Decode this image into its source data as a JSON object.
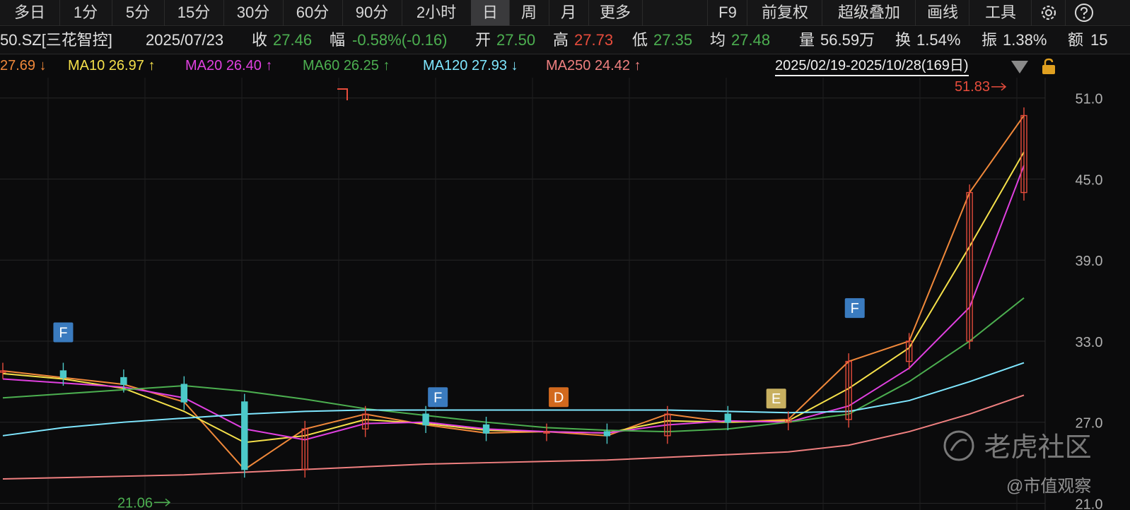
{
  "tabs": {
    "items": [
      "多日",
      "1分",
      "5分",
      "15分",
      "30分",
      "60分",
      "90分",
      "2小时",
      "日",
      "周",
      "月",
      "更多"
    ],
    "active": "日"
  },
  "toolbar": {
    "f9": "F9",
    "adjust": "前复权",
    "overlay": "超级叠加",
    "draw": "画线",
    "tools": "工具"
  },
  "quote": {
    "code_name": "50.SZ[三花智控]",
    "date": "2025/07/23",
    "close_label": "收",
    "close": "27.46",
    "change_label": "幅",
    "change": "-0.58%(-0.16)",
    "open_label": "开",
    "open": "27.50",
    "high_label": "高",
    "high": "27.73",
    "low_label": "低",
    "low": "27.35",
    "avg_label": "均",
    "avg": "27.48",
    "vol_label": "量",
    "volume": "56.59万",
    "turnover_label": "换",
    "turnover": "1.54%",
    "amp_label": "振",
    "amplitude": "1.38%",
    "amount_label": "额",
    "amount": "15"
  },
  "ma_legend": [
    {
      "name": "",
      "value": "27.69",
      "arrow": "↓",
      "color": "#f0883a"
    },
    {
      "name": "MA10",
      "value": "26.97",
      "arrow": "↑",
      "color": "#f5e04a"
    },
    {
      "name": "MA20",
      "value": "26.40",
      "arrow": "↑",
      "color": "#e040e0"
    },
    {
      "name": "MA60",
      "value": "26.25",
      "arrow": "↑",
      "color": "#4caf50"
    },
    {
      "name": "MA120",
      "value": "27.93",
      "arrow": "↓",
      "color": "#7fe7ff"
    },
    {
      "name": "MA250",
      "value": "24.42",
      "arrow": "↑",
      "color": "#f08080"
    }
  ],
  "date_range": "2025/02/19-2025/10/28(169日)",
  "chart_data": {
    "type": "line",
    "title": "",
    "xlabel": "",
    "ylabel": "",
    "ylim": [
      21.0,
      52.0
    ],
    "y_ticks": [
      "51.0",
      "45.0",
      "39.0",
      "33.0",
      "27.0",
      "21.0"
    ],
    "x": [
      0,
      10,
      20,
      30,
      40,
      50,
      60,
      70,
      80,
      90,
      100,
      110,
      120,
      130,
      140,
      150,
      160,
      169
    ],
    "series": [
      {
        "name": "close",
        "color": "#f0883a",
        "values": [
          30.8,
          30.3,
          29.8,
          28.5,
          23.5,
          26.5,
          27.6,
          26.8,
          26.2,
          26.3,
          26.0,
          27.6,
          27.0,
          27.2,
          31.5,
          33.0,
          44.0,
          49.7
        ]
      },
      {
        "name": "MA10",
        "color": "#f5e04a",
        "values": [
          30.6,
          30.2,
          29.5,
          27.8,
          25.5,
          26.0,
          27.2,
          26.9,
          26.4,
          26.3,
          26.2,
          27.1,
          27.0,
          27.1,
          29.5,
          32.5,
          40.0,
          47.0
        ]
      },
      {
        "name": "MA20",
        "color": "#e040e0",
        "values": [
          30.2,
          29.9,
          29.6,
          28.8,
          26.5,
          25.7,
          26.9,
          27.0,
          26.5,
          26.3,
          26.2,
          26.8,
          27.1,
          27.0,
          28.2,
          31.0,
          35.5,
          46.0
        ]
      },
      {
        "name": "MA60",
        "color": "#4caf50",
        "values": [
          28.8,
          29.1,
          29.4,
          29.7,
          29.3,
          28.7,
          28.0,
          27.5,
          27.0,
          26.6,
          26.4,
          26.3,
          26.5,
          27.0,
          27.6,
          30.0,
          33.0,
          36.2
        ]
      },
      {
        "name": "MA120",
        "color": "#7fe7ff",
        "values": [
          26.0,
          26.6,
          27.0,
          27.3,
          27.6,
          27.8,
          27.9,
          27.9,
          27.9,
          27.9,
          27.9,
          27.9,
          27.8,
          27.7,
          27.8,
          28.6,
          30.0,
          31.4
        ]
      },
      {
        "name": "MA250",
        "color": "#f08080",
        "values": [
          22.8,
          22.9,
          23.0,
          23.1,
          23.3,
          23.5,
          23.7,
          23.9,
          24.0,
          24.1,
          24.2,
          24.4,
          24.6,
          24.8,
          25.3,
          26.3,
          27.6,
          29.0
        ]
      }
    ],
    "annotations": {
      "high_label": "51.83",
      "low_label": "21.06",
      "event_markers": [
        {
          "label": "F",
          "color": "#3a7bbf",
          "x_index": 10,
          "y": 32.5
        },
        {
          "label": "F",
          "color": "#3a7bbf",
          "x_index": 72,
          "y": 27.7
        },
        {
          "label": "D",
          "color": "#d2691e",
          "x_index": 92,
          "y": 27.7
        },
        {
          "label": "E",
          "color": "#c8b060",
          "x_index": 128,
          "y": 27.6
        },
        {
          "label": "F",
          "color": "#3a7bbf",
          "x_index": 141,
          "y": 34.3
        }
      ]
    }
  },
  "watermark": {
    "brand": "老虎社区",
    "handle": "@市值观察"
  }
}
